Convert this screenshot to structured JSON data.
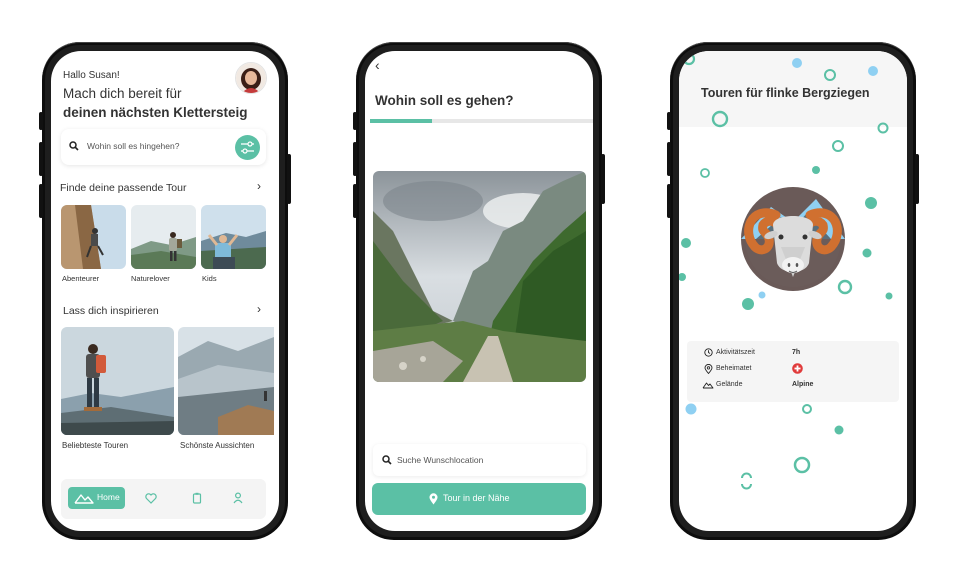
{
  "phone1": {
    "greeting": "Hallo Susan!",
    "headline_1": "Mach dich bereit für",
    "headline_2": "deinen nächsten Klettersteig",
    "search_placeholder": "Wohin soll es hingehen?",
    "section_1_title": "Finde deine passende Tour",
    "tour_types": [
      {
        "label": "Abenteurer"
      },
      {
        "label": "Naturelover"
      },
      {
        "label": "Kids"
      }
    ],
    "section_2_title": "Lass dich inspirieren",
    "inspirations": [
      {
        "label": "Beliebteste Touren"
      },
      {
        "label": "Schönste Aussichten"
      }
    ],
    "nav": {
      "home_label": "Home",
      "items": [
        "mountain-icon",
        "heart-icon",
        "clipboard-icon",
        "user-icon"
      ]
    }
  },
  "phone2": {
    "back_icon": "chevron-left-icon",
    "title": "Wohin soll es gehen?",
    "progress": 0.28,
    "search_placeholder": "Suche Wunschlocation",
    "cta_label": "Tour in der Nähe"
  },
  "phone3": {
    "title": "Touren für flinke Bergziegen",
    "info": [
      {
        "label": "Aktivitätszeit",
        "value": "7h",
        "icon": "clock-icon"
      },
      {
        "label": "Beheimatet",
        "value": "",
        "icon": "location-icon",
        "value_icon": "swiss-flag-icon"
      },
      {
        "label": "Gelände",
        "value": "Alpine",
        "icon": "mountain-icon"
      }
    ]
  },
  "colors": {
    "accent": "#5bc0a5",
    "light_blue": "#8fd0f2",
    "phone_frame": "#0d0d0d"
  }
}
